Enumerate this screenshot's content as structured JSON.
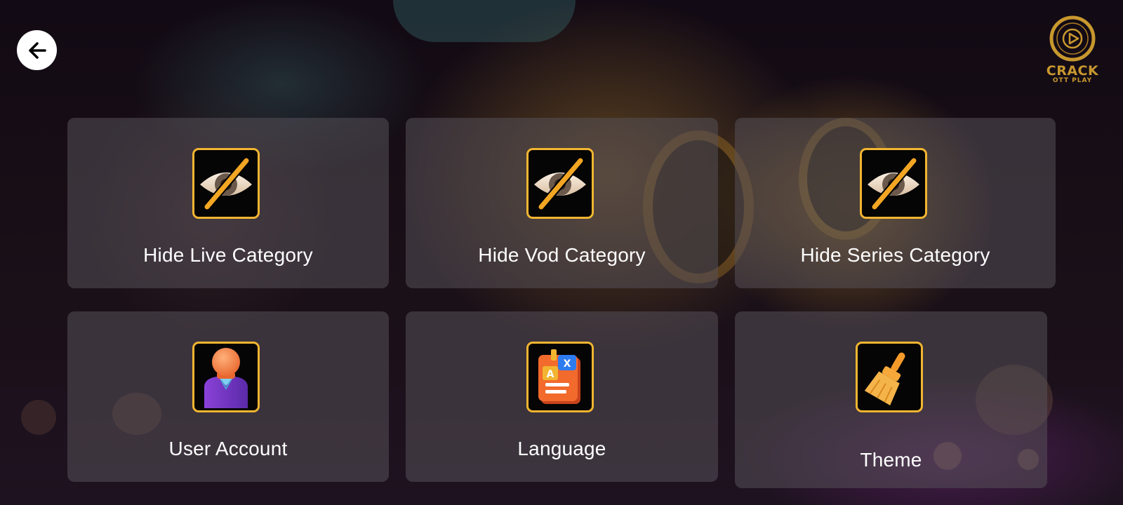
{
  "header": {
    "back_icon": "arrow-left-icon",
    "logo": {
      "icon": "play-circle-icon",
      "line1": "CRACK",
      "line2": "OTT PLAY",
      "color": "#c8982e"
    }
  },
  "colors": {
    "icon_border": "#f2b531",
    "tile_background": "rgba(85,80,88,0.55)",
    "text": "#ffffff"
  },
  "tiles": [
    {
      "label": "Hide Live Category",
      "icon": "eye-slash-icon"
    },
    {
      "label": "Hide Vod Category",
      "icon": "eye-slash-icon"
    },
    {
      "label": "Hide Series Category",
      "icon": "eye-slash-icon"
    },
    {
      "label": "User Account",
      "icon": "user-icon"
    },
    {
      "label": "Language",
      "icon": "translate-book-icon"
    },
    {
      "label": "Theme",
      "icon": "brush-icon"
    }
  ]
}
